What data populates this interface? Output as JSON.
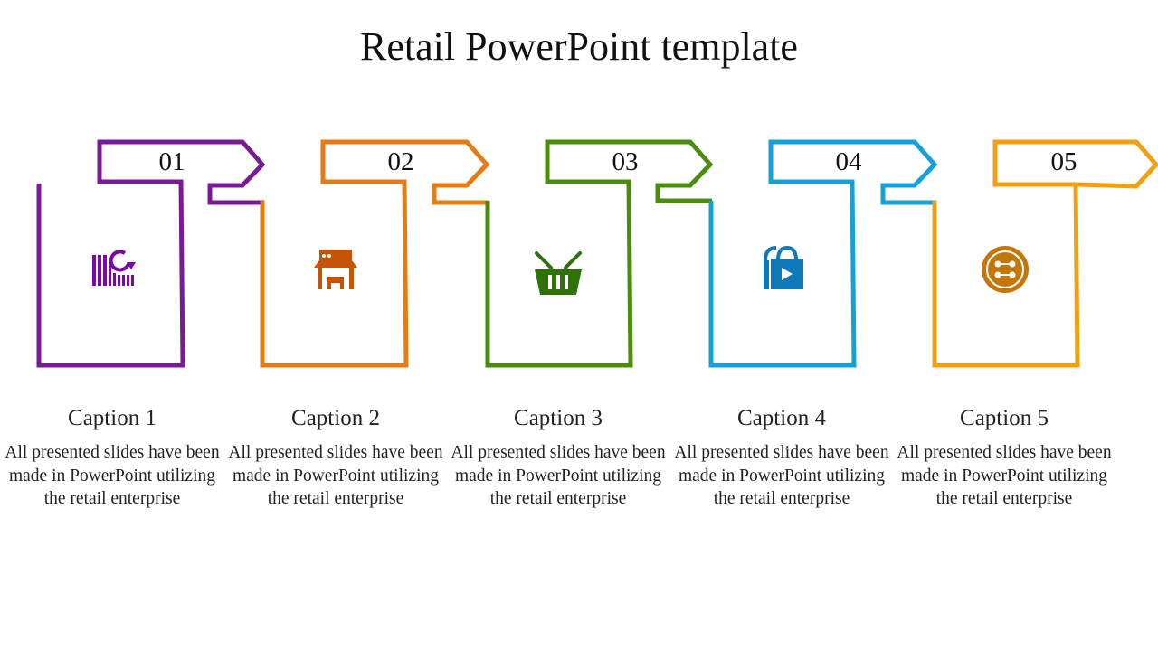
{
  "slide": {
    "title": "Retail PowerPoint template"
  },
  "steps": [
    {
      "number": "01",
      "color": "#781b94",
      "icon_color": "#7a07a6",
      "icon": "barcode-refresh-icon",
      "caption": "Caption 1",
      "body": "All presented slides have been made in PowerPoint utilizing the retail enterprise"
    },
    {
      "number": "02",
      "color": "#e67a14",
      "icon_color": "#c45508",
      "icon": "store-front-icon",
      "caption": "Caption 2",
      "body": "All presented slides have been made in PowerPoint utilizing the retail enterprise"
    },
    {
      "number": "03",
      "color": "#4c8c0c",
      "icon_color": "#2f7208",
      "icon": "shopping-basket-icon",
      "caption": "Caption 3",
      "body": "All presented slides have been made in PowerPoint utilizing the retail enterprise"
    },
    {
      "number": "04",
      "color": "#16a0da",
      "icon_color": "#0e79b6",
      "icon": "shopping-bag-play-icon",
      "caption": "Caption 4",
      "body": "All presented slides have been made in PowerPoint utilizing the retail enterprise"
    },
    {
      "number": "05",
      "color": "#f0a010",
      "icon_color": "#c57608",
      "icon": "button-icon",
      "caption": "Caption 5",
      "body": "All presented slides have been made in PowerPoint utilizing the retail enterprise"
    }
  ]
}
